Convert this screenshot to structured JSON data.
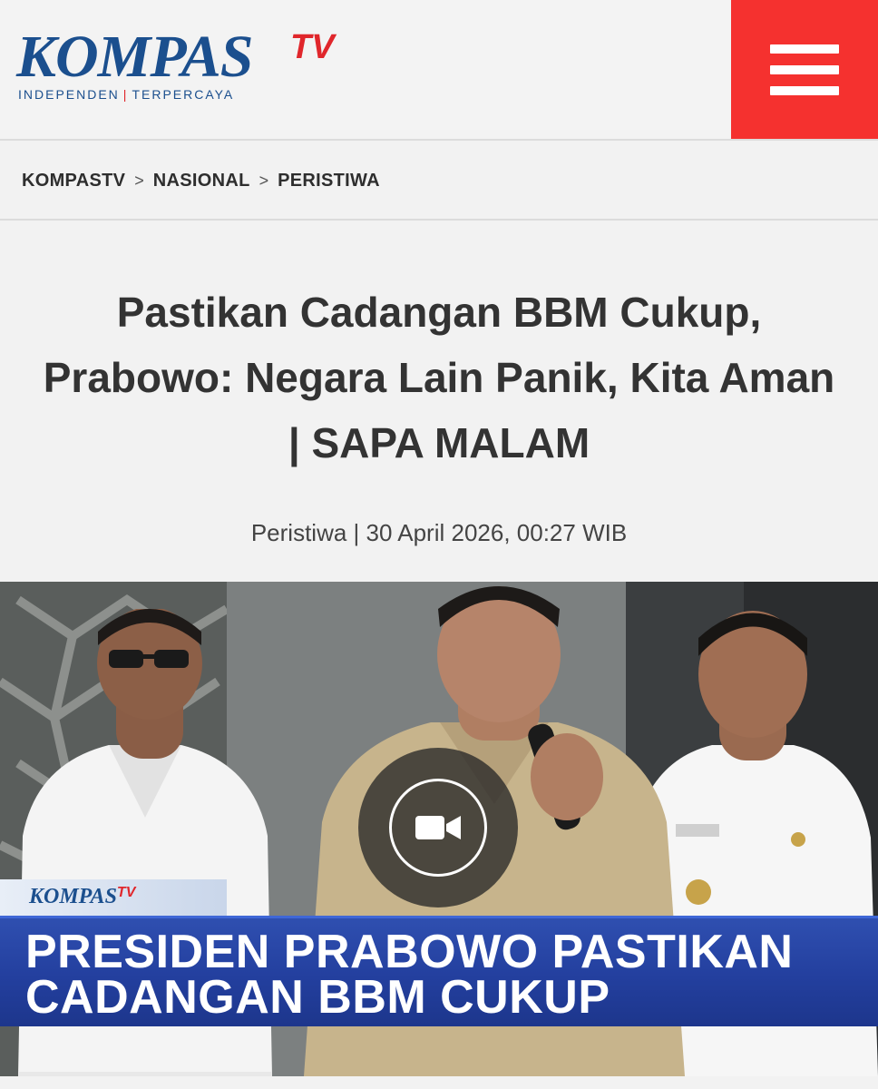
{
  "header": {
    "logo_text": "KOMPAS",
    "logo_tv": "TV",
    "logo_tagline_left": "INDEPENDEN",
    "logo_tagline_sep": "|",
    "logo_tagline_right": "TERPERCAYA",
    "menu_icon": "hamburger-menu-icon",
    "colors": {
      "brand_blue": "#1b4f8e",
      "brand_red": "#e0262b",
      "menu_bg": "#f5312f"
    }
  },
  "breadcrumb": {
    "items": [
      "KOMPASTV",
      "NASIONAL",
      "PERISTIWA"
    ],
    "separator": ">"
  },
  "article": {
    "title": "Pastikan Cadangan BBM Cukup, Prabowo: Negara Lain Panik, Kita Aman | SAPA MALAM",
    "category": "Peristiwa",
    "meta_sep": "|",
    "datetime": "30 April 2026, 00:27 WIB"
  },
  "video": {
    "play_icon": "video-camera-icon",
    "overlay_logo": "KOMPAS",
    "overlay_logo_tv": "TV",
    "headline_line1": "PRESIDEN PRABOWO PASTIKAN",
    "headline_line2": "CADANGAN BBM CUKUP",
    "colors": {
      "band": "#233f9e"
    }
  }
}
